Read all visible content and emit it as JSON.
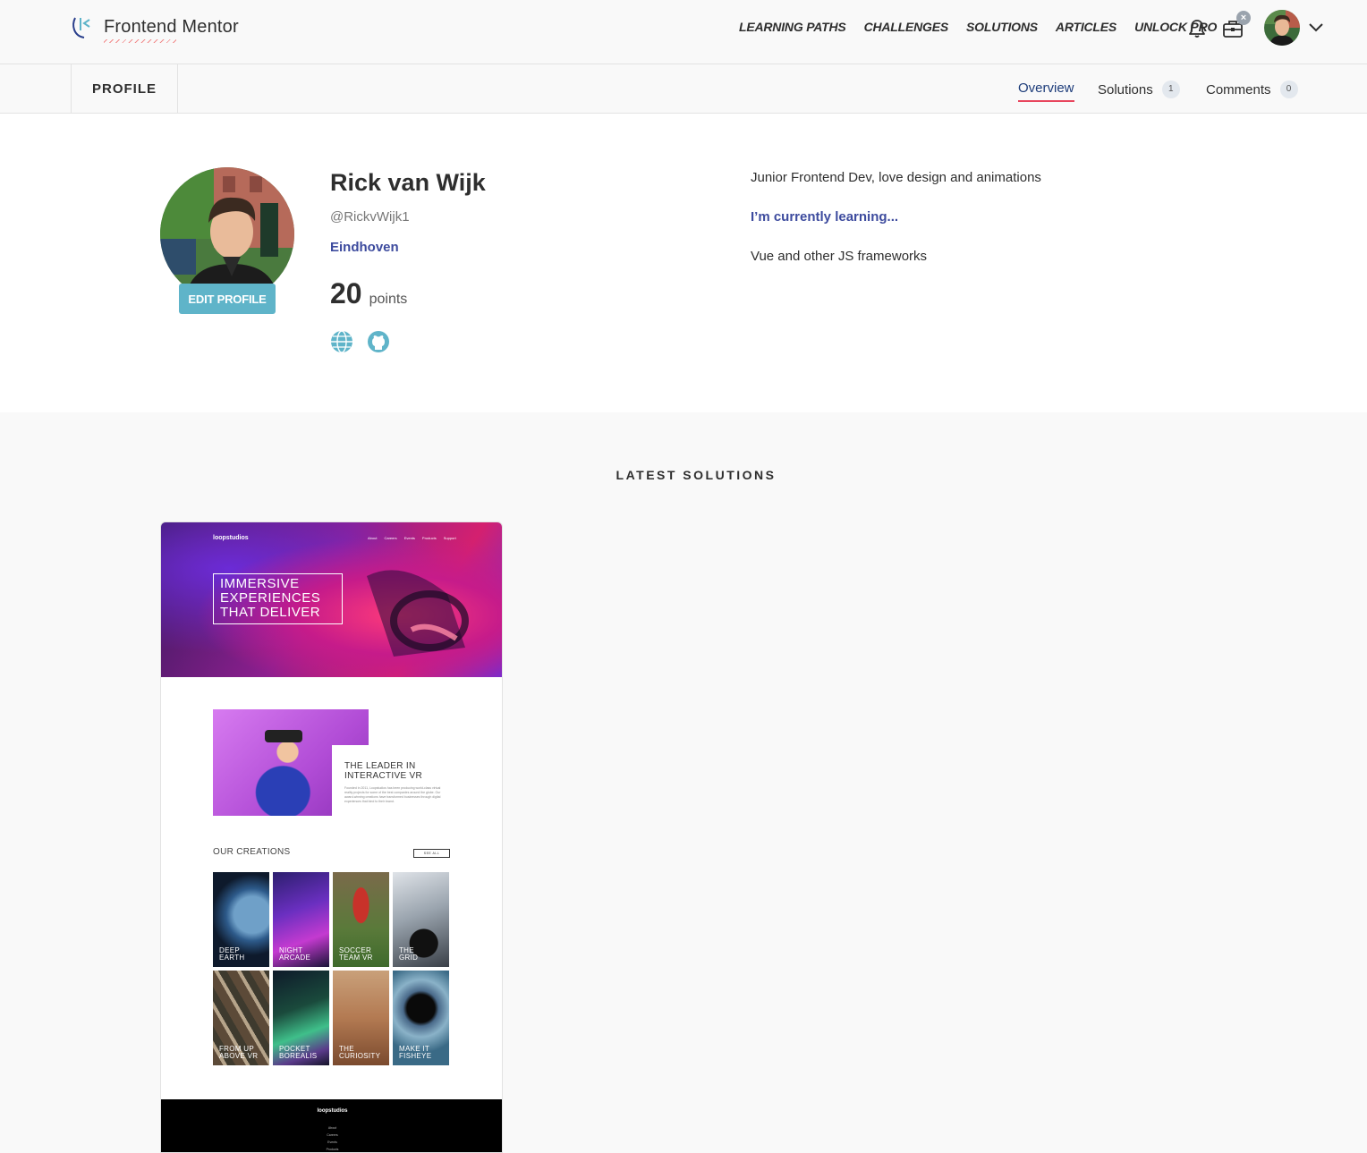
{
  "brand": {
    "name": "Frontend Mentor"
  },
  "nav": {
    "links": [
      "LEARNING PATHS",
      "CHALLENGES",
      "SOLUTIONS",
      "ARTICLES",
      "UNLOCK PRO"
    ],
    "icons": {
      "notifications": "bell-icon",
      "pro": "briefcase-icon",
      "dismiss": "close-icon",
      "menu": "chevron-down-icon"
    }
  },
  "subnav": {
    "section": "PROFILE",
    "tabs": [
      {
        "label": "Overview",
        "count": null,
        "active": true
      },
      {
        "label": "Solutions",
        "count": "1",
        "active": false
      },
      {
        "label": "Comments",
        "count": "0",
        "active": false
      }
    ]
  },
  "profile": {
    "name": "Rick van Wijk",
    "handle": "@RickvWijk1",
    "location": "Eindhoven",
    "points_value": "20",
    "points_label": "points",
    "edit_label": "EDIT PROFILE",
    "bio": "Junior Frontend Dev, love design and animations",
    "learning_heading": "I’m currently learning...",
    "learning_text": "Vue and other JS frameworks",
    "social": [
      "globe-icon",
      "github-icon"
    ]
  },
  "solutions": {
    "title": "LATEST SOLUTIONS",
    "cards": [
      {
        "preview": {
          "logo": "loopstudios",
          "menu": [
            "About",
            "Careers",
            "Events",
            "Products",
            "Support"
          ],
          "hero_lines": [
            "IMMERSIVE",
            "EXPERIENCES",
            "THAT DELIVER"
          ],
          "leader_title_lines": [
            "THE LEADER IN",
            "INTERACTIVE VR"
          ],
          "leader_text": "Founded in 2011, Loopstudios has been producing world-class virtual reality projects for some of the best companies around the globe. Our award-winning creations have transformed businesses through digital experiences that bind to their brand.",
          "creations_title": "OUR CREATIONS",
          "see_all": "SEE ALL",
          "tiles": [
            "DEEP\nEARTH",
            "NIGHT\nARCADE",
            "SOCCER\nTEAM VR",
            "THE\nGRID",
            "FROM UP\nABOVE VR",
            "POCKET\nBOREALIS",
            "THE\nCURIOSITY",
            "MAKE IT\nFISHEYE"
          ],
          "footer_logo": "loopstudios",
          "footer_links": [
            "About",
            "Careers",
            "Events",
            "Products"
          ]
        }
      }
    ]
  },
  "colors": {
    "accent_blue": "#3d4b9e",
    "accent_cyan": "#5fb4c9",
    "active_tab_underline": "#e8455d"
  }
}
